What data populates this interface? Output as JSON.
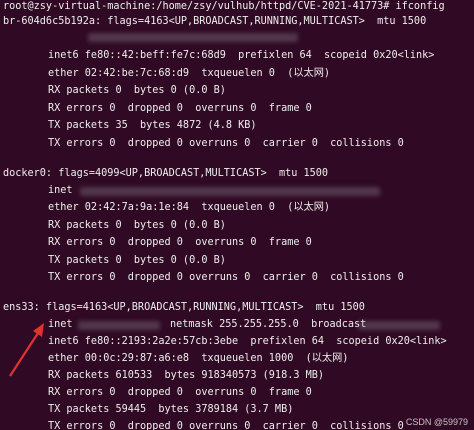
{
  "prompt_line": "root@zsy-virtual-machine:/home/zsy/vulhub/httpd/CVE-2021-41773# ifconfig",
  "interfaces": [
    {
      "header": "br-604d6c5b192a: flags=4163<UP,BROADCAST,RUNNING,MULTICAST>  mtu 1500",
      "inet": "inet",
      "inet6": "inet6 fe80::42:beff:fe7c:68d9  prefixlen 64  scopeid 0x20<link>",
      "ether": "ether 02:42:be:7c:68:d9  txqueuelen 0  (以太网)",
      "rx_packets": "RX packets 0  bytes 0 (0.0 B)",
      "rx_errors": "RX errors 0  dropped 0  overruns 0  frame 0",
      "tx_packets": "TX packets 35  bytes 4872 (4.8 KB)",
      "tx_errors": "TX errors 0  dropped 0 overruns 0  carrier 0  collisions 0"
    },
    {
      "header": "docker0: flags=4099<UP,BROADCAST,MULTICAST>  mtu 1500",
      "inet": "inet",
      "ether": "ether 02:42:7a:9a:1e:84  txqueuelen 0  (以太网)",
      "rx_packets": "RX packets 0  bytes 0 (0.0 B)",
      "rx_errors": "RX errors 0  dropped 0  overruns 0  frame 0",
      "tx_packets": "TX packets 0  bytes 0 (0.0 B)",
      "tx_errors": "TX errors 0  dropped 0 overruns 0  carrier 0  collisions 0"
    },
    {
      "header": "ens33: flags=4163<UP,BROADCAST,RUNNING,MULTICAST>  mtu 1500",
      "inet": "inet",
      "netmask": "netmask 255.255.255.0  broadcast",
      "inet6": "inet6 fe80::2193:2a2e:57cb:3ebe  prefixlen 64  scopeid 0x20<link>",
      "ether": "ether 00:0c:29:87:a6:e8  txqueuelen 1000  (以太网)",
      "rx_packets": "RX packets 610533  bytes 918340573 (918.3 MB)",
      "rx_errors": "RX errors 0  dropped 0  overruns 0  frame 0",
      "tx_packets": "TX packets 59445  bytes 3789184 (3.7 MB)",
      "tx_errors": "TX errors 0  dropped 0 overruns 0  carrier 0  collisions 0"
    }
  ],
  "watermark": "CSDN @59979",
  "colors": {
    "background": "#300a24",
    "text": "#eeeeec",
    "arrow": "#e0322e"
  }
}
